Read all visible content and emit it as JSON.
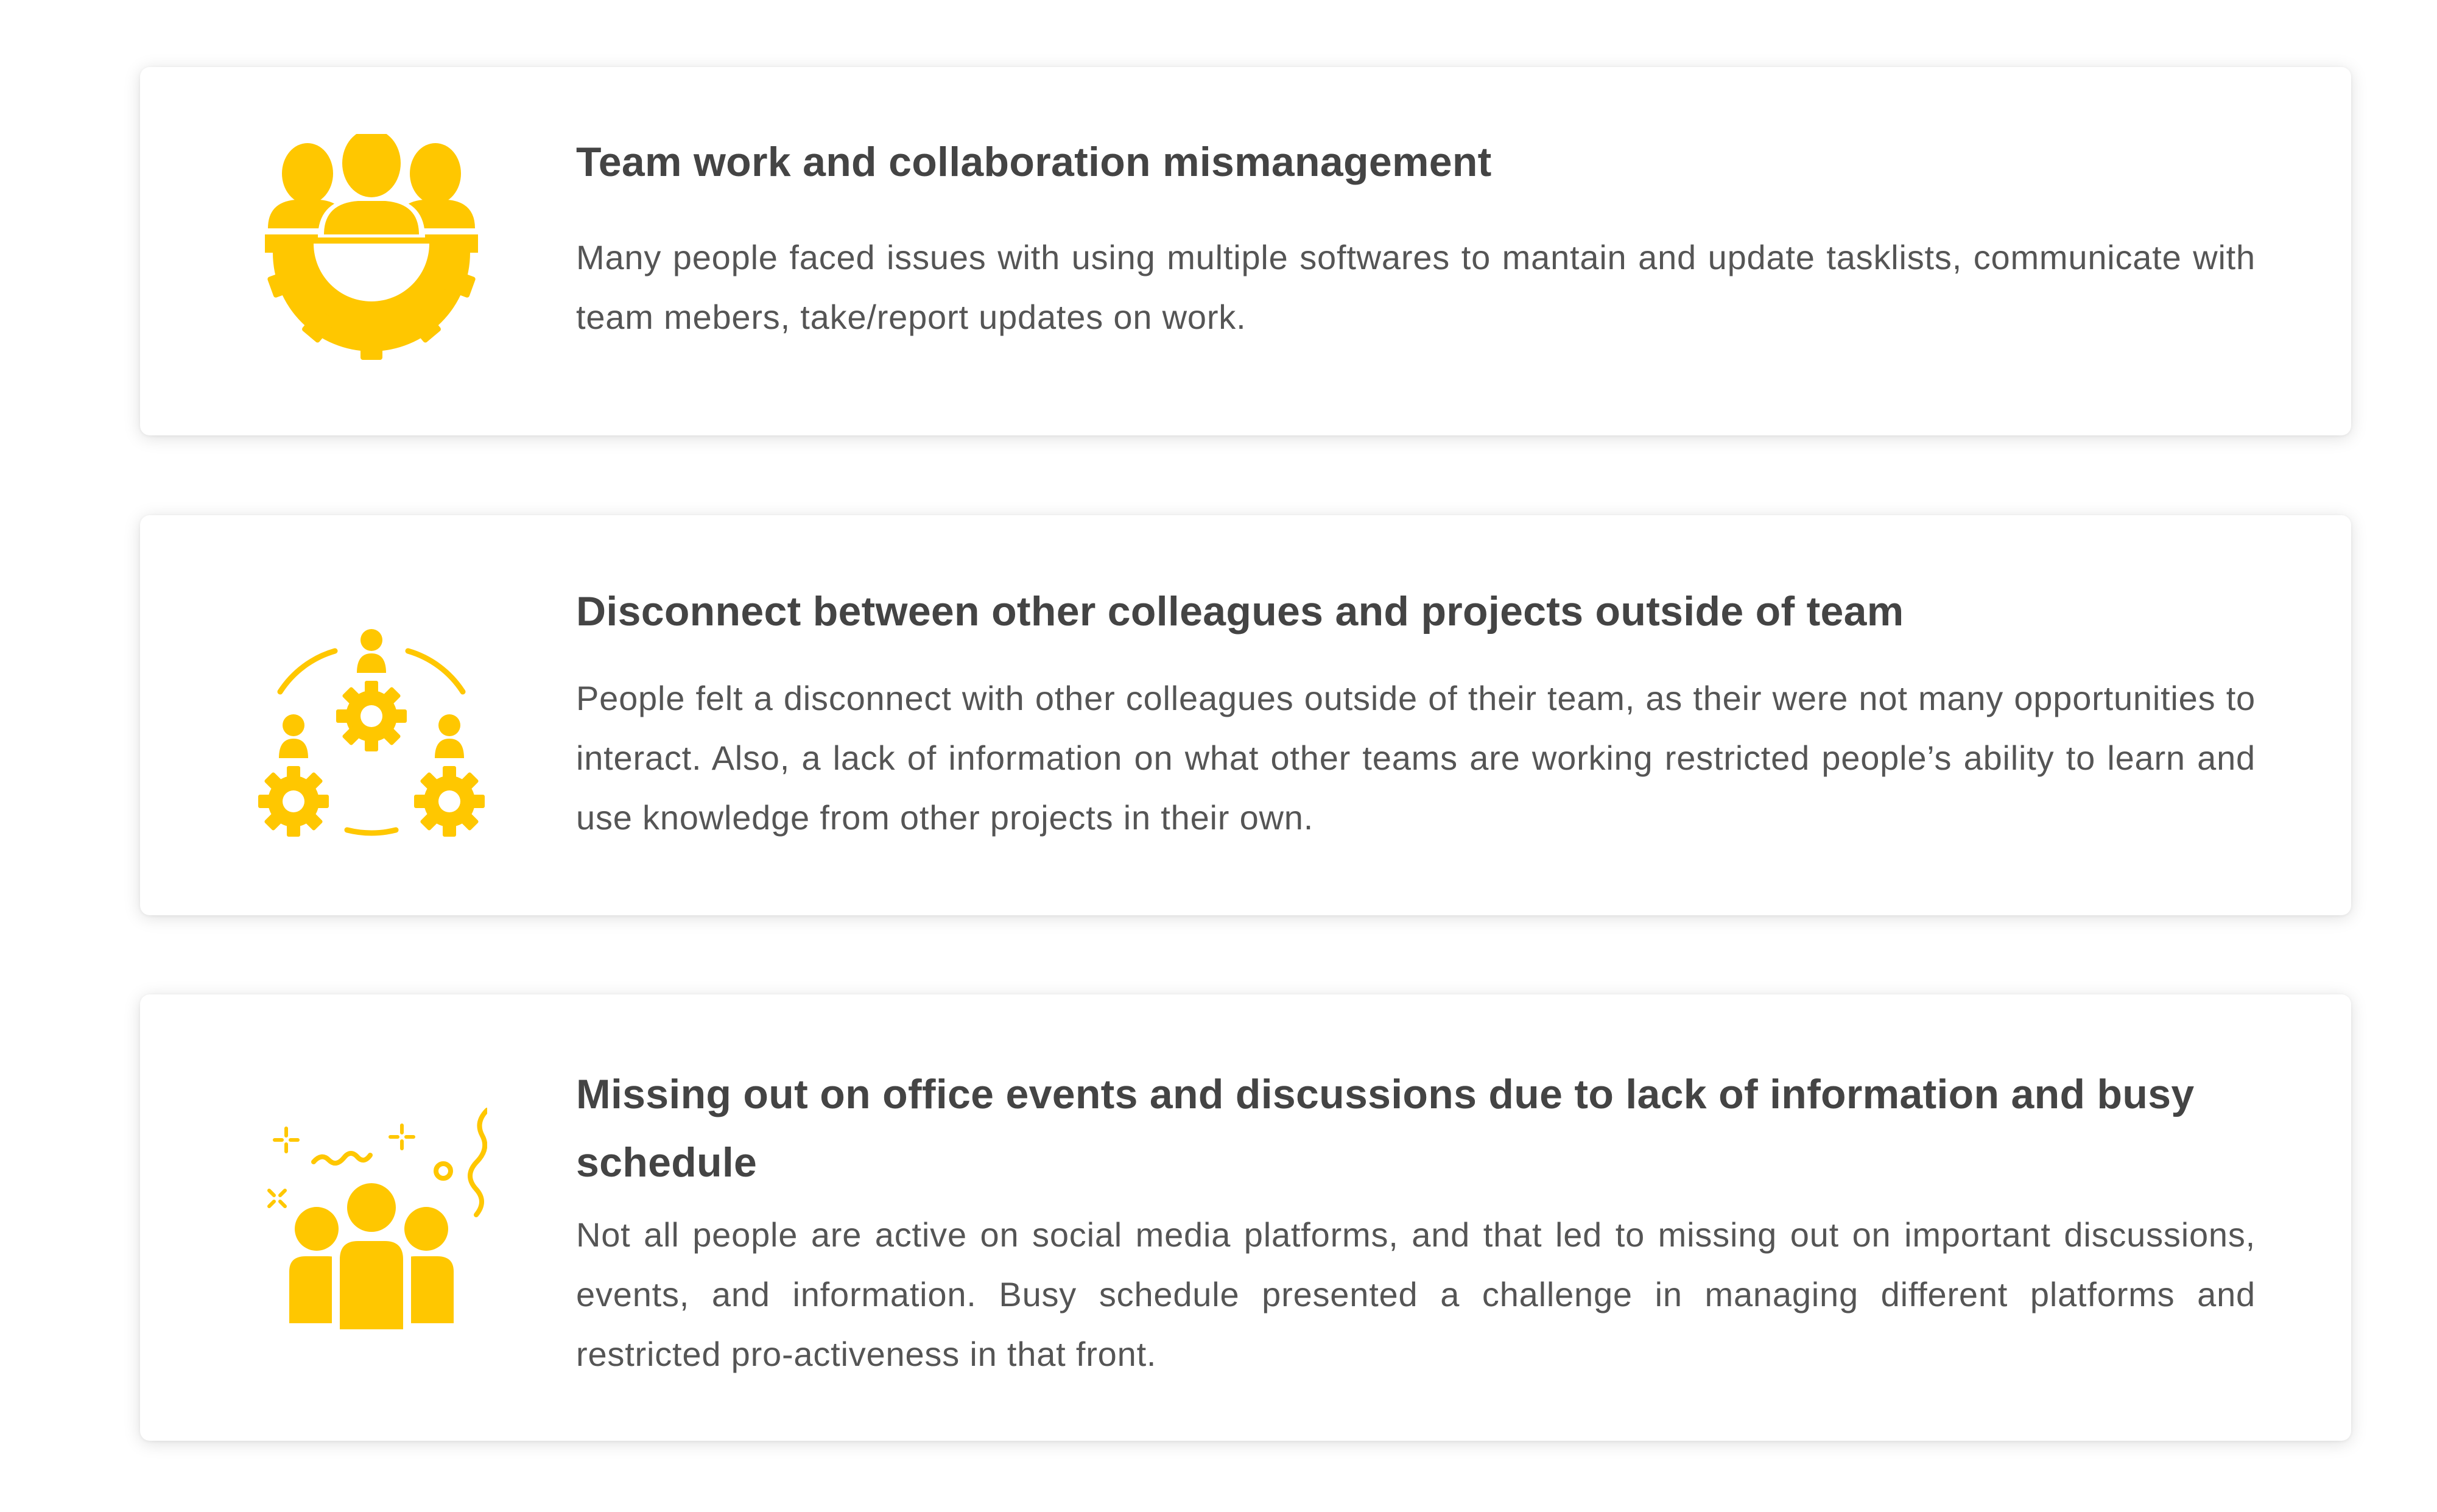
{
  "colors": {
    "accent": "#FFC700",
    "title": "#444444",
    "body": "#555555",
    "card_background": "#FFFFFF"
  },
  "cards": [
    {
      "icon": "teamwork-gear-icon",
      "title": "Team work and collaboration mismanagement",
      "description": "Many people faced issues with using multiple softwares to mantain and update tasklists, communicate with team mebers, take/report updates on work."
    },
    {
      "icon": "network-people-gears-icon",
      "title": "Disconnect between other colleagues and projects outside of team",
      "description": "People felt a disconnect with other colleagues outside of their team, as their were not many opportunities to interact. Also, a lack of information on what other teams are working restricted people’s ability to learn and use knowledge from other projects in their own."
    },
    {
      "icon": "celebration-group-icon",
      "title": "Missing out on office events and discussions due to lack of information and busy schedule",
      "description": "Not all people are active on social media platforms, and that led to missing out on important discussions, events, and information. Busy schedule presented a challenge in managing different platforms and restricted pro-activeness in that front."
    }
  ]
}
